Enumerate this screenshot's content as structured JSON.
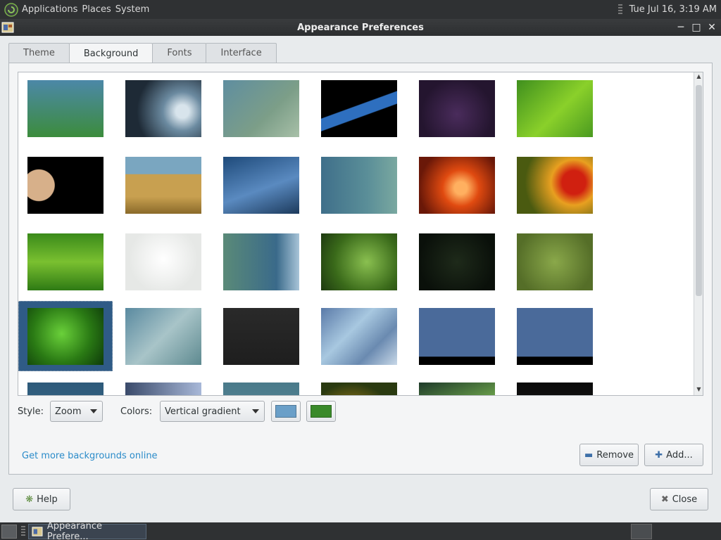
{
  "top_panel": {
    "menus": [
      "Applications",
      "Places",
      "System"
    ],
    "clock": "Tue Jul 16,  3:19 AM"
  },
  "window": {
    "title": "Appearance Preferences"
  },
  "tabs": [
    {
      "label": "Theme",
      "active": false
    },
    {
      "label": "Background",
      "active": true
    },
    {
      "label": "Fonts",
      "active": false
    },
    {
      "label": "Interface",
      "active": false
    }
  ],
  "wallpapers": {
    "selected_row": 3,
    "selected_col": 0,
    "rows": [
      [
        {
          "name": "vertical-gradient",
          "bg": "linear-gradient(#4c88a8, #3c8c3c)"
        },
        {
          "name": "water-drop",
          "bg": "radial-gradient(circle at 75% 55%, #d8e4ec 0 10%, #6b8aa0 30%, #1e2a36 70%)"
        },
        {
          "name": "blue-green-blur",
          "bg": "linear-gradient(135deg, #5f8ea0, #7c9e88 60%, #a8c0a8)"
        },
        {
          "name": "arch-prism",
          "bg": "linear-gradient(160deg, #000 45%, #2e6fbf 46% 60%, #000 61%)"
        },
        {
          "name": "arch-bubbles",
          "bg": "radial-gradient(circle at 50% 60%, #4a2c5c, #24152f 70%)"
        },
        {
          "name": "green-leaf",
          "bg": "linear-gradient(135deg, #3f8f1e, #8ad02a 55%, #4a9a20)"
        }
      ],
      [
        {
          "name": "jupiter",
          "bg": "radial-gradient(circle at 15% 50%, #d7b08a 0 22%, #000 23%)"
        },
        {
          "name": "grass-beach",
          "bg": "linear-gradient(#7aa6c0 0 30%, #c8a050 31% 70%, #8a6a2a)"
        },
        {
          "name": "blue-leaf-drops",
          "bg": "linear-gradient(160deg, #1e4a7a, #5a8ac0 55%, #1c3a5c)"
        },
        {
          "name": "teal-bokeh",
          "bg": "linear-gradient(90deg, #3f6f8a, #5a8e98 60%, #7aa8a0)"
        },
        {
          "name": "orange-flower",
          "bg": "radial-gradient(circle at 55% 55%, #ffb060 0 12%, #e04a10 35%, #6a1808 80%)"
        },
        {
          "name": "red-flower",
          "bg": "radial-gradient(circle at 75% 45%, #d02010 0 18%, #e8a020 35%, #4a5a10 75%)"
        }
      ],
      [
        {
          "name": "green-grass",
          "bg": "linear-gradient(#3a8a1a, #7ac030 50%, #2e7a14)"
        },
        {
          "name": "mate-white",
          "bg": "radial-gradient(circle at 50% 45%, #ffffff, #e6e8e6 70%)"
        },
        {
          "name": "blue-ribbon",
          "bg": "linear-gradient(90deg, #5a8a78, #3a6a8a 70%, #a8c4d8)"
        },
        {
          "name": "ladybug-leaf",
          "bg": "radial-gradient(circle at 60% 50%, #8ac050, #3a6a1a 60%, #1e3a10)"
        },
        {
          "name": "mate-dark",
          "bg": "radial-gradient(circle at 50% 50%, #1e2a1a, #0a100a 80%)"
        },
        {
          "name": "mate-green",
          "bg": "radial-gradient(circle at 50% 50%, #8aa84a, #556e28 80%)"
        }
      ],
      [
        {
          "name": "dew-leaf",
          "bg": "radial-gradient(circle at 45% 45%, #6ad03a, #2a7a14 55%, #0e3a0a)"
        },
        {
          "name": "blue-waves",
          "bg": "linear-gradient(135deg, #5a8aa0, #a8c4c8 50%, #5e8a90)"
        },
        {
          "name": "archlinux-dark",
          "bg": "linear-gradient(#2a2a2a, #1e1e1e)"
        },
        {
          "name": "crystal-blue",
          "bg": "linear-gradient(135deg, #5a7aa8, #a8c8e0 40%, #6a8ab0 70%, #c8d8e8)"
        },
        {
          "name": "crystal-blue-dark",
          "bg": "linear-gradient(#4a6a9a 0 85%, #000 86%)"
        },
        {
          "name": "crystal-blue-dark-2",
          "bg": "linear-gradient(#4a6a9a 0 85%, #000 86%)"
        }
      ],
      [
        {
          "name": "blue-partial",
          "bg": "linear-gradient(#2e5a7a, #3a6a8a)"
        },
        {
          "name": "blue-lights-partial",
          "bg": "linear-gradient(90deg, #3a4a6a, #a8b8d8)"
        },
        {
          "name": "teal-partial",
          "bg": "linear-gradient(#4a7a8a, #5a8a9a)"
        },
        {
          "name": "yellow-partial",
          "bg": "radial-gradient(circle at 40% 80%, #e0a020, #2a3a10 70%)"
        },
        {
          "name": "aurora-partial",
          "bg": "linear-gradient(160deg, #1e3a2a, #6aa04a 50%, #1e3a2a)"
        },
        {
          "name": "dark-partial",
          "bg": "linear-gradient(#0a0a0a, #1e1e1e)"
        }
      ]
    ]
  },
  "controls": {
    "style_label": "Style:",
    "style_value": "Zoom",
    "colors_label": "Colors:",
    "colors_value": "Vertical gradient",
    "primary_color": "#6a9fc8",
    "secondary_color": "#3a8a2a",
    "more_link": "Get more backgrounds online",
    "remove_label": "Remove",
    "add_label": "Add..."
  },
  "footer": {
    "help_label": "Help",
    "close_label": "Close"
  },
  "taskbar": {
    "task_label": "Appearance Prefere..."
  }
}
